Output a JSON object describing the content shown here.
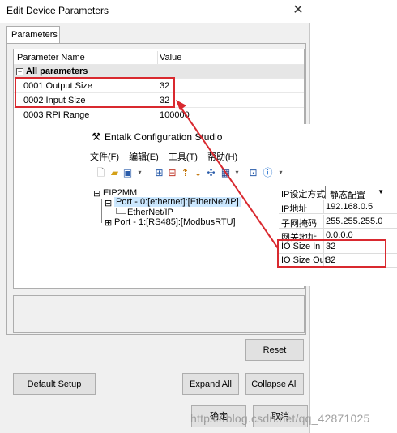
{
  "dialog": {
    "title": "Edit Device Parameters",
    "close_glyph": "✕",
    "tab_label": "Parameters",
    "grid": {
      "col_name": "Parameter Name",
      "col_value": "Value",
      "group_label": "All parameters",
      "group_toggle": "−",
      "rows": [
        {
          "name": "0001 Output Size",
          "value": "32"
        },
        {
          "name": "0002 Input Size",
          "value": "32"
        },
        {
          "name": "0003 RPI Range",
          "value": "100000"
        }
      ]
    },
    "buttons": {
      "reset": "Reset",
      "default_setup": "Default Setup",
      "expand_all": "Expand All",
      "collapse_all": "Collapse All",
      "ok": "确定",
      "cancel": "取消"
    }
  },
  "overlay": {
    "app_title": "Entalk Configuration Studio",
    "menu": [
      "文件(F)",
      "编辑(E)",
      "工具(T)",
      "帮助(H)"
    ],
    "tree": {
      "root": "EIP2MM",
      "port0": "Port - 0:[ethernet]:[EtherNet/IP]",
      "port0_child": "EtherNet/IP",
      "port1": "Port - 1:[RS485]:[ModbusRTU]"
    },
    "props": [
      {
        "key": "IP设定方式",
        "value": "静态配置"
      },
      {
        "key": "IP地址",
        "value": "192.168.0.5"
      },
      {
        "key": "子网掩码",
        "value": "255.255.255.0"
      },
      {
        "key": "网关地址",
        "value": "0.0.0.0"
      },
      {
        "key": "IO Size In",
        "value": "32"
      },
      {
        "key": "IO Size Out",
        "value": "32"
      }
    ]
  },
  "watermark": "https://blog.csdn.net/qq_42871025",
  "colors": {
    "highlight": "#d9292f",
    "selection": "#cce8ff",
    "arrow": "#d9292f"
  }
}
